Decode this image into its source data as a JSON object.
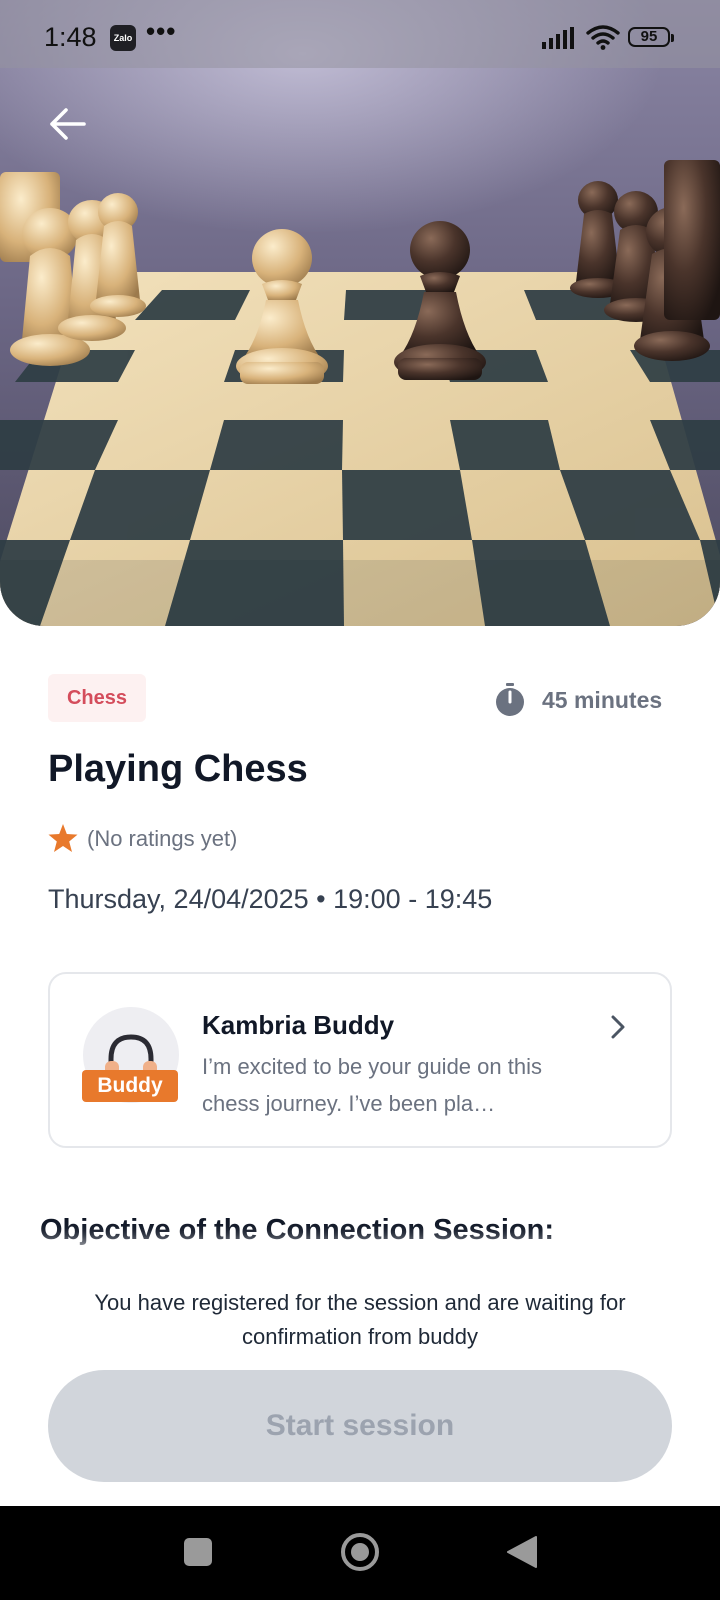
{
  "status_bar": {
    "time": "1:48",
    "zalo_label": "Zalo",
    "notification_dots": "•••",
    "battery": "95"
  },
  "hero": {
    "image_subject": "chess-board-photo"
  },
  "session": {
    "category": "Chess",
    "duration": "45 minutes",
    "title": "Playing Chess",
    "rating_text": "(No ratings yet)",
    "schedule": "Thursday, 24/04/2025 • 19:00 - 19:45"
  },
  "buddy": {
    "badge": "Buddy",
    "name": "Kambria Buddy",
    "bio": "I’m excited to be your guide on this chess journey. I’ve been pla…"
  },
  "objective": {
    "heading": "Objective of the Connection Session:"
  },
  "footer": {
    "status_message": "You have registered for the session and are waiting for confirmation from buddy",
    "start_button_label": "Start session"
  },
  "colors": {
    "accent_red": "#d44d5c",
    "chip_background": "#fdf1f1",
    "buddy_orange": "#e8792c",
    "star_orange": "#e8792c",
    "disabled_button": "#d1d5db"
  },
  "icons": {
    "back": "arrow-left-icon",
    "timer": "stopwatch-icon",
    "star": "star-icon",
    "chevron": "chevron-right-icon",
    "avatar": "headphones-icon"
  }
}
